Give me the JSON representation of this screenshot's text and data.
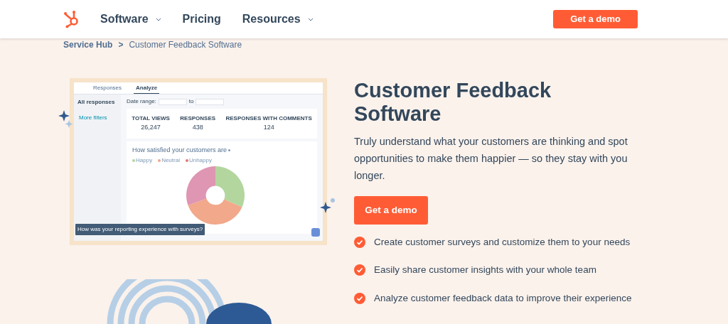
{
  "nav": {
    "items": [
      {
        "label": "Software",
        "dropdown": true
      },
      {
        "label": "Pricing",
        "dropdown": false
      },
      {
        "label": "Resources",
        "dropdown": true
      }
    ],
    "cta": "Get a demo"
  },
  "breadcrumb": {
    "parent": "Service Hub",
    "separator": ">",
    "current": "Customer Feedback Software"
  },
  "preview": {
    "tabs": [
      {
        "label": "Responses",
        "selected": false
      },
      {
        "label": "Analyze",
        "selected": true
      }
    ],
    "sidebar": {
      "title": "All responses",
      "filter": "More filters"
    },
    "date_label": "Date range:",
    "date_to": "to",
    "stats": [
      {
        "label": "TOTAL VIEWS",
        "value": "26,247"
      },
      {
        "label": "RESPONSES",
        "value": "438"
      },
      {
        "label": "RESPONSES WITH COMMENTS",
        "value": "124"
      }
    ],
    "chart_title": "How satisfied your customers are",
    "legend": [
      {
        "label": "Happy",
        "color": "#b3d69e"
      },
      {
        "label": "Neutral",
        "color": "#f2a88a"
      },
      {
        "label": "Unhappy",
        "color": "#e07a7a"
      }
    ],
    "feedback_prompt": "How was your reporting experience with surveys?"
  },
  "hero": {
    "title": "Customer Feedback Software",
    "description": "Truly understand what your customers are thinking and spot opportunities to make them happier — so they stay with you longer.",
    "cta": "Get a demo",
    "features": [
      "Create customer surveys and customize them to your needs",
      "Easily share customer insights with your whole team",
      "Analyze customer feedback data to improve their experience"
    ]
  }
}
